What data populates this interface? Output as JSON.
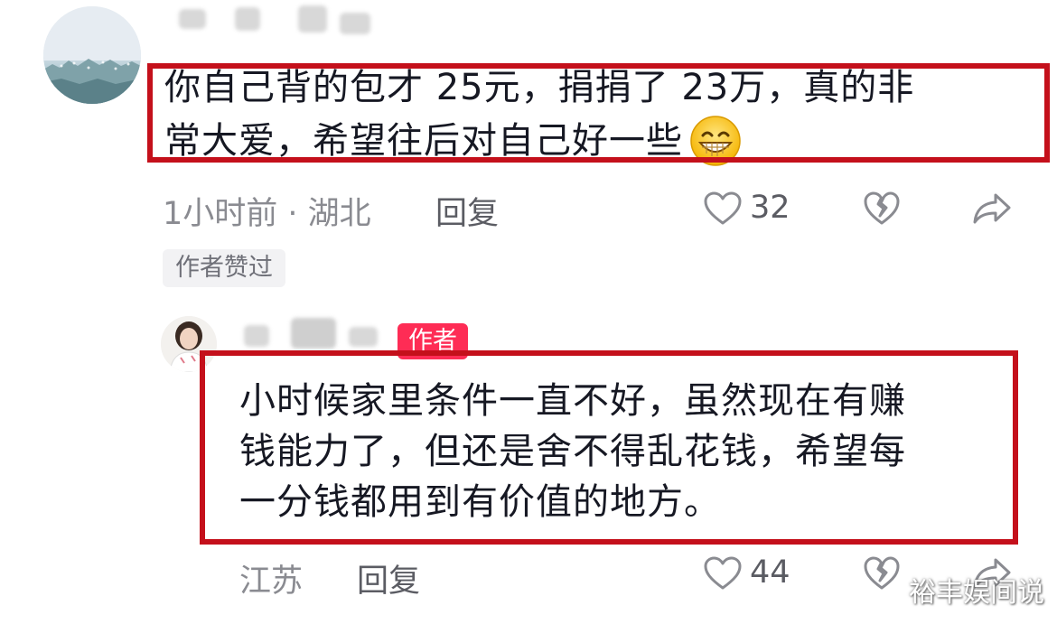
{
  "comment1": {
    "text_line1": "你自己背的包才 25元，捐捐了 23万，真的非",
    "text_line2": "常大爱，希望往后对自己好一些",
    "emoji": "grinning-face-emoji",
    "time_location": "1小时前 · 湖北",
    "reply_label": "回复",
    "like_count": "32",
    "author_liked_badge": "作者赞过"
  },
  "comment2": {
    "author_badge": "作者",
    "text_line1": "小时候家里条件一直不好，虽然现在有赚",
    "text_line2": "钱能力了，但还是舍不得乱花钱，希望每",
    "text_line3": "一分钱都用到有价值的地方。",
    "location": "江苏",
    "reply_label": "回复",
    "like_count": "44"
  },
  "icons": [
    "heart-icon",
    "broken-heart-icon",
    "share-icon"
  ],
  "colors": {
    "highlight_frame": "#c4101b",
    "author_badge": "#fe2c55",
    "muted_text": "#8a8b91"
  },
  "watermark": "裕丰娱间说"
}
